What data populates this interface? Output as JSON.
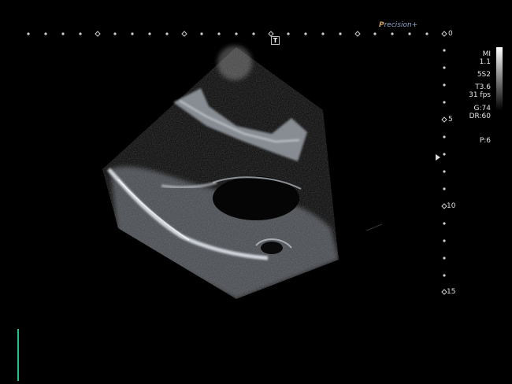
{
  "brand": {
    "prefix": "P",
    "rest": "recision",
    "suffix": "+"
  },
  "t_marker": "T",
  "depth_labels": [
    "0",
    "5",
    "10",
    "15"
  ],
  "params": {
    "mi_label": "MI",
    "mi_value": "1.1",
    "probe": "5S2",
    "thermal_index": "T3.6",
    "frame_rate": "31 fps",
    "gain": "G:74",
    "dynamic_range": "DR:60",
    "preset": "P:6"
  },
  "colors": {
    "background": "#000000",
    "ecg": "#22c08a",
    "brand_accent": "#8fa6c6"
  }
}
